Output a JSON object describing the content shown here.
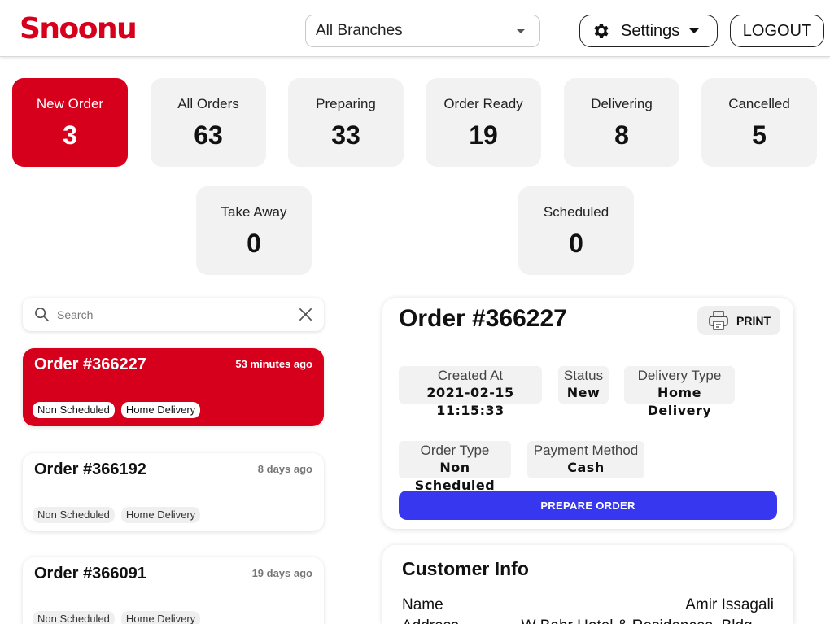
{
  "header": {
    "logo": "Snoonu",
    "branch_select": "All Branches",
    "settings_label": "Settings",
    "logout_label": "LOGOUT"
  },
  "stats": [
    {
      "label": "New Order",
      "count": "3"
    },
    {
      "label": "All Orders",
      "count": "63"
    },
    {
      "label": "Preparing",
      "count": "33"
    },
    {
      "label": "Order Ready",
      "count": "19"
    },
    {
      "label": "Delivering",
      "count": "8"
    },
    {
      "label": "Cancelled",
      "count": "5"
    },
    {
      "label": "Take Away",
      "count": "0"
    },
    {
      "label": "Scheduled",
      "count": "0"
    }
  ],
  "search": {
    "placeholder": "Search",
    "value": ""
  },
  "orders": [
    {
      "number": "Order #366227",
      "ago": "53 minutes ago",
      "tags": [
        "Non Scheduled",
        "Home Delivery"
      ]
    },
    {
      "number": "Order #366192",
      "ago": "8 days ago",
      "tags": [
        "Non Scheduled",
        "Home Delivery"
      ]
    },
    {
      "number": "Order #366091",
      "ago": "19 days ago",
      "tags": [
        "Non Scheduled",
        "Home Delivery"
      ]
    }
  ],
  "detail": {
    "title": "Order #366227",
    "print_label": "PRINT",
    "fields": [
      {
        "label": "Created At",
        "value": "2021-02-15 11:15:33"
      },
      {
        "label": "Status",
        "value": "New"
      },
      {
        "label": "Delivery Type",
        "value": "Home Delivery"
      },
      {
        "label": "Order Type",
        "value": "Non Scheduled"
      },
      {
        "label": "Payment Method",
        "value": "Cash"
      }
    ],
    "prepare_label": "PREPARE ORDER"
  },
  "customer": {
    "title": "Customer Info",
    "name_label": "Name",
    "name_value": "Amir Issagali",
    "address_label": "Address",
    "address_value": "W Bahr Hotel & Residences, Bldg. ..."
  },
  "colors": {
    "brand": "#d7001c",
    "primary_button": "#3737f0",
    "card_bg": "#f2f2f2"
  }
}
